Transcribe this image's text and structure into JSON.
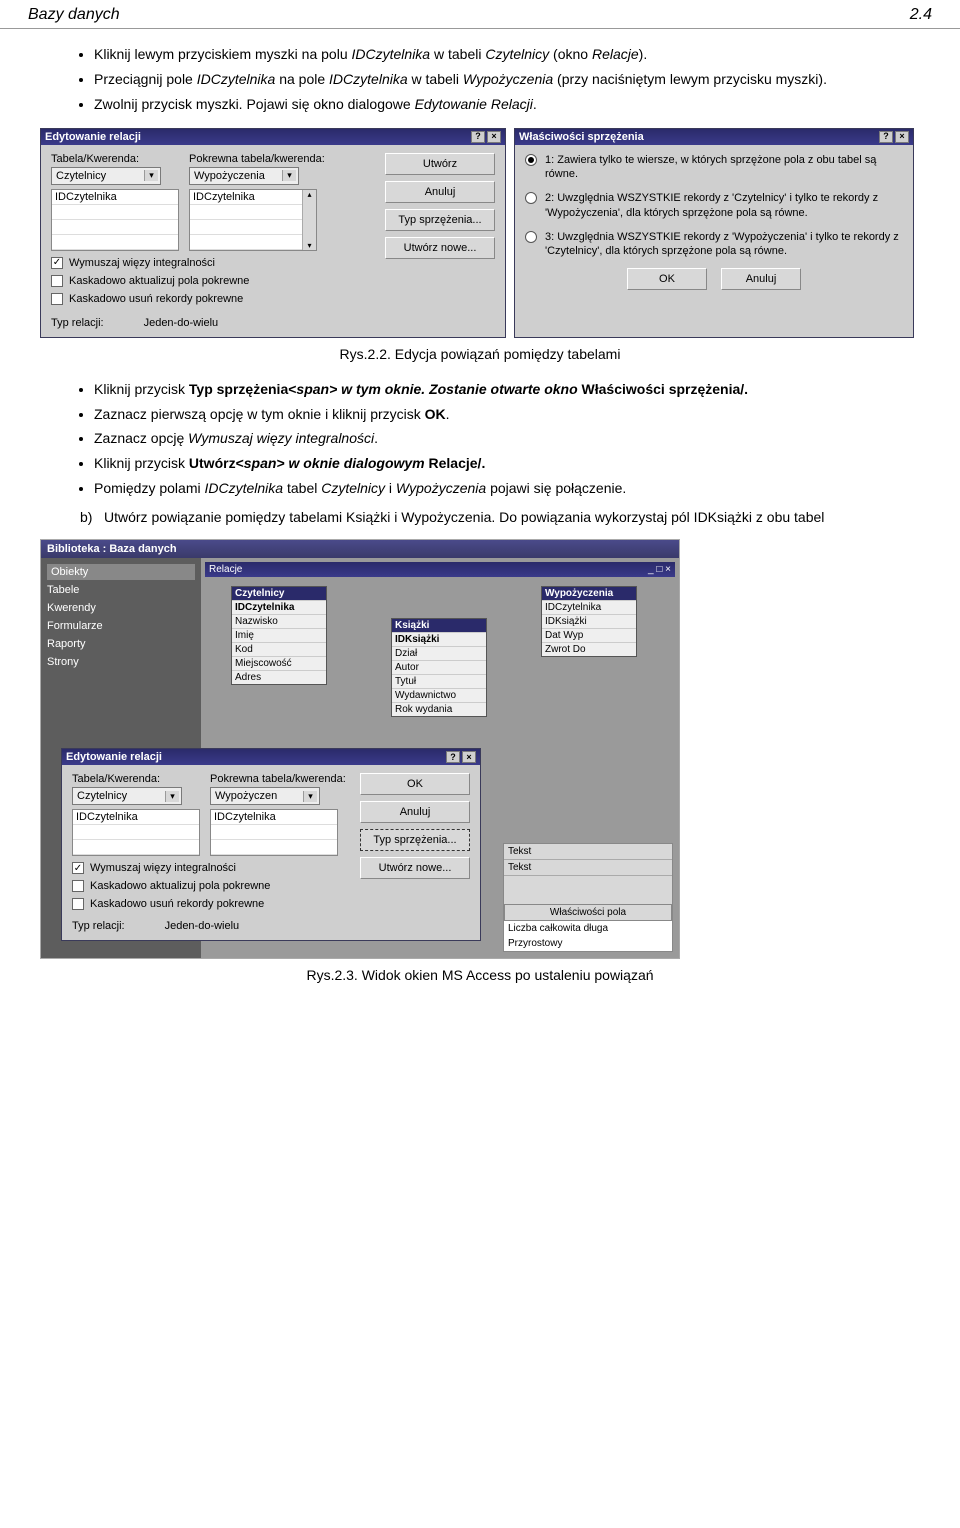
{
  "header": {
    "left": "Bazy danych",
    "right": "2.4"
  },
  "bullets1": [
    {
      "pre": "Kliknij lewym przyciskiem myszki na polu ",
      "it1": "IDCzytelnika",
      "mid": " w tabeli ",
      "it2": "Czytelnicy",
      "mid2": " (okno ",
      "it3": "Relacje",
      "post": ")."
    },
    {
      "pre": "Przeciągnij pole ",
      "it1": "IDCzytelnika",
      "mid": " na pole ",
      "it2": "IDCzytelnika",
      "mid2": " w tabeli ",
      "it3": "Wypożyczenia",
      "post": " (przy naciśniętym lewym przycisku myszki)."
    },
    {
      "pre": "Zwolnij przycisk myszki. Pojawi się okno dialogowe ",
      "it1": "Edytowanie Relacji",
      "mid": ".",
      "it2": "",
      "mid2": "",
      "it3": "",
      "post": ""
    }
  ],
  "dlg1": {
    "title": "Edytowanie relacji",
    "l1": "Tabela/Kwerenda:",
    "l2": "Pokrewna tabela/kwerenda:",
    "c1": "Czytelnicy",
    "c2": "Wypożyczenia",
    "f1": "IDCzytelnika",
    "f2": "IDCzytelnika",
    "btn_create": "Utwórz",
    "btn_cancel": "Anuluj",
    "btn_join": "Typ sprzężenia...",
    "btn_new": "Utwórz nowe...",
    "chk1": "Wymuszaj więzy integralności",
    "chk2": "Kaskadowo aktualizuj pola pokrewne",
    "chk3": "Kaskadowo usuń rekordy pokrewne",
    "rel_l": "Typ relacji:",
    "rel_v": "Jeden-do-wielu"
  },
  "dlg2": {
    "title": "Właściwości sprzężenia",
    "opt1": "1: Zawiera tylko te wiersze, w których sprzężone pola z obu tabel są równe.",
    "opt2": "2: Uwzględnia WSZYSTKIE rekordy z 'Czytelnicy' i tylko te rekordy z 'Wypożyczenia', dla których sprzężone pola są równe.",
    "opt3": "3: Uwzględnia WSZYSTKIE rekordy z 'Wypożyczenia' i tylko te rekordy z 'Czytelnicy', dla których sprzężone pola są równe.",
    "ok": "OK",
    "cancel": "Anuluj"
  },
  "caption1": "Rys.2.2. Edycja powiązań pomiędzy tabelami",
  "bullets2": [
    "Kliknij przycisk |Typ sprzężenia| w tym oknie. Zostanie otwarte okno /Właściwości sprzężenia/.",
    "Zaznacz pierwszą opcję w tym oknie i kliknij przycisk |OK|.",
    "Zaznacz opcję /Wymuszaj więzy integralności/.",
    "Kliknij przycisk |Utwórz| w oknie dialogowym /Relacje/.",
    "Pomiędzy polami /IDCzytelnika/ tabel /Czytelnicy/ i /Wypożyczenia/ pojawi się połączenie."
  ],
  "sectionB": "Utwórz powiązanie pomiędzy tabelami Książki i Wypożyczenia. Do powiązania wykorzystaj pól IDKsiążki z obu tabel",
  "fig2": {
    "title": "Biblioteka : Baza danych",
    "side": [
      "Obiekty",
      "Tabele",
      "Kwerendy",
      "Formularze",
      "Raporty",
      "Strony"
    ],
    "rel_title": "Relacje",
    "tables": {
      "c": {
        "h": "Czytelnicy",
        "f": [
          "IDCzytelnika",
          "Nazwisko",
          "Imię",
          "Kod",
          "Miejscowość",
          "Adres"
        ]
      },
      "k": {
        "h": "Książki",
        "f": [
          "IDKsiążki",
          "Dział",
          "Autor",
          "Tytuł",
          "Wydawnictwo",
          "Rok wydania"
        ]
      },
      "w": {
        "h": "Wypożyczenia",
        "f": [
          "IDCzytelnika",
          "IDKsiążki",
          "Dat Wyp",
          "Zwrot Do"
        ]
      }
    },
    "edit_title": "Edytowanie relacji",
    "prop_title": "Właściwości pola",
    "prop1": "Liczba całkowita długa",
    "prop2": "Przyrostowy",
    "tekst": "Tekst"
  },
  "caption2": "Rys.2.3. Widok okien MS Access po ustaleniu powiązań"
}
